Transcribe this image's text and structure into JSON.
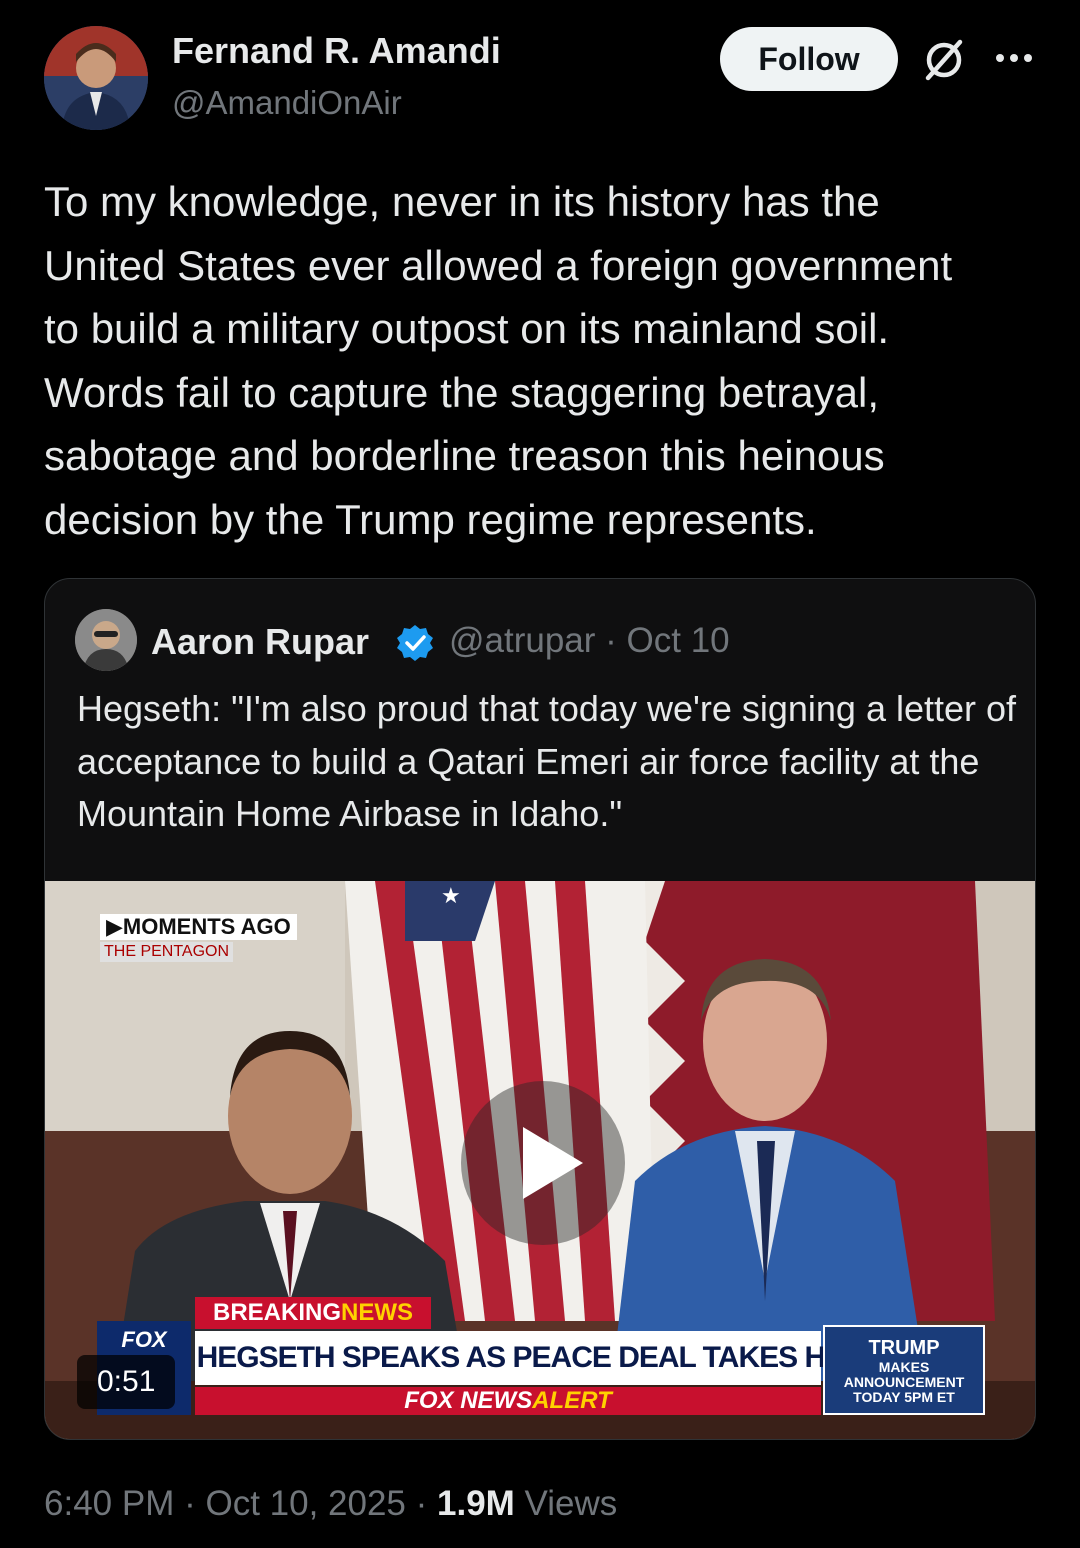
{
  "author": {
    "name": "Fernand R. Amandi",
    "handle": "@AmandiOnAir"
  },
  "actions": {
    "follow_label": "Follow"
  },
  "tweet": {
    "text": "To my knowledge, never in its history has the\nUnited States ever allowed a foreign government\nto build a military outpost on its mainland soil.\nWords fail to capture the staggering betrayal,\nsabotage and borderline treason this heinous\ndecision by the Trump regime represents."
  },
  "quote": {
    "name": "Aaron Rupar",
    "handle": "@atrupar",
    "date": "Oct 10",
    "text": "Hegseth: \"I'm also proud that today we're signing a letter of acceptance to build a Qatari Emeri air force facility at the Mountain Home Airbase in Idaho.\"",
    "video": {
      "duration": "0:51",
      "chyron_tag": "▶MOMENTS AGO",
      "chyron_location": "THE PENTAGON",
      "breaking_a": "BREAKING ",
      "breaking_b": "NEWS",
      "headline": "SEC HEGSETH SPEAKS AS PEACE DEAL TAKES HOLD",
      "alert_a": "FOX NEWS ",
      "alert_b": "ALERT",
      "logo_text": "FOX",
      "promo_title": "TRUMP",
      "promo_line1": "MAKES",
      "promo_line2": "ANNOUNCEMENT",
      "promo_line3": "TODAY 5PM ET"
    }
  },
  "footer": {
    "time": "6:40 PM",
    "date": "Oct 10, 2025",
    "views_count": "1.9M",
    "views_label": "Views",
    "sep": " · "
  },
  "colors": {
    "background": "#000000",
    "text": "#e7e9ea",
    "muted": "#71767b",
    "verified": "#1d9bf0",
    "follow_bg": "#eff3f4"
  }
}
